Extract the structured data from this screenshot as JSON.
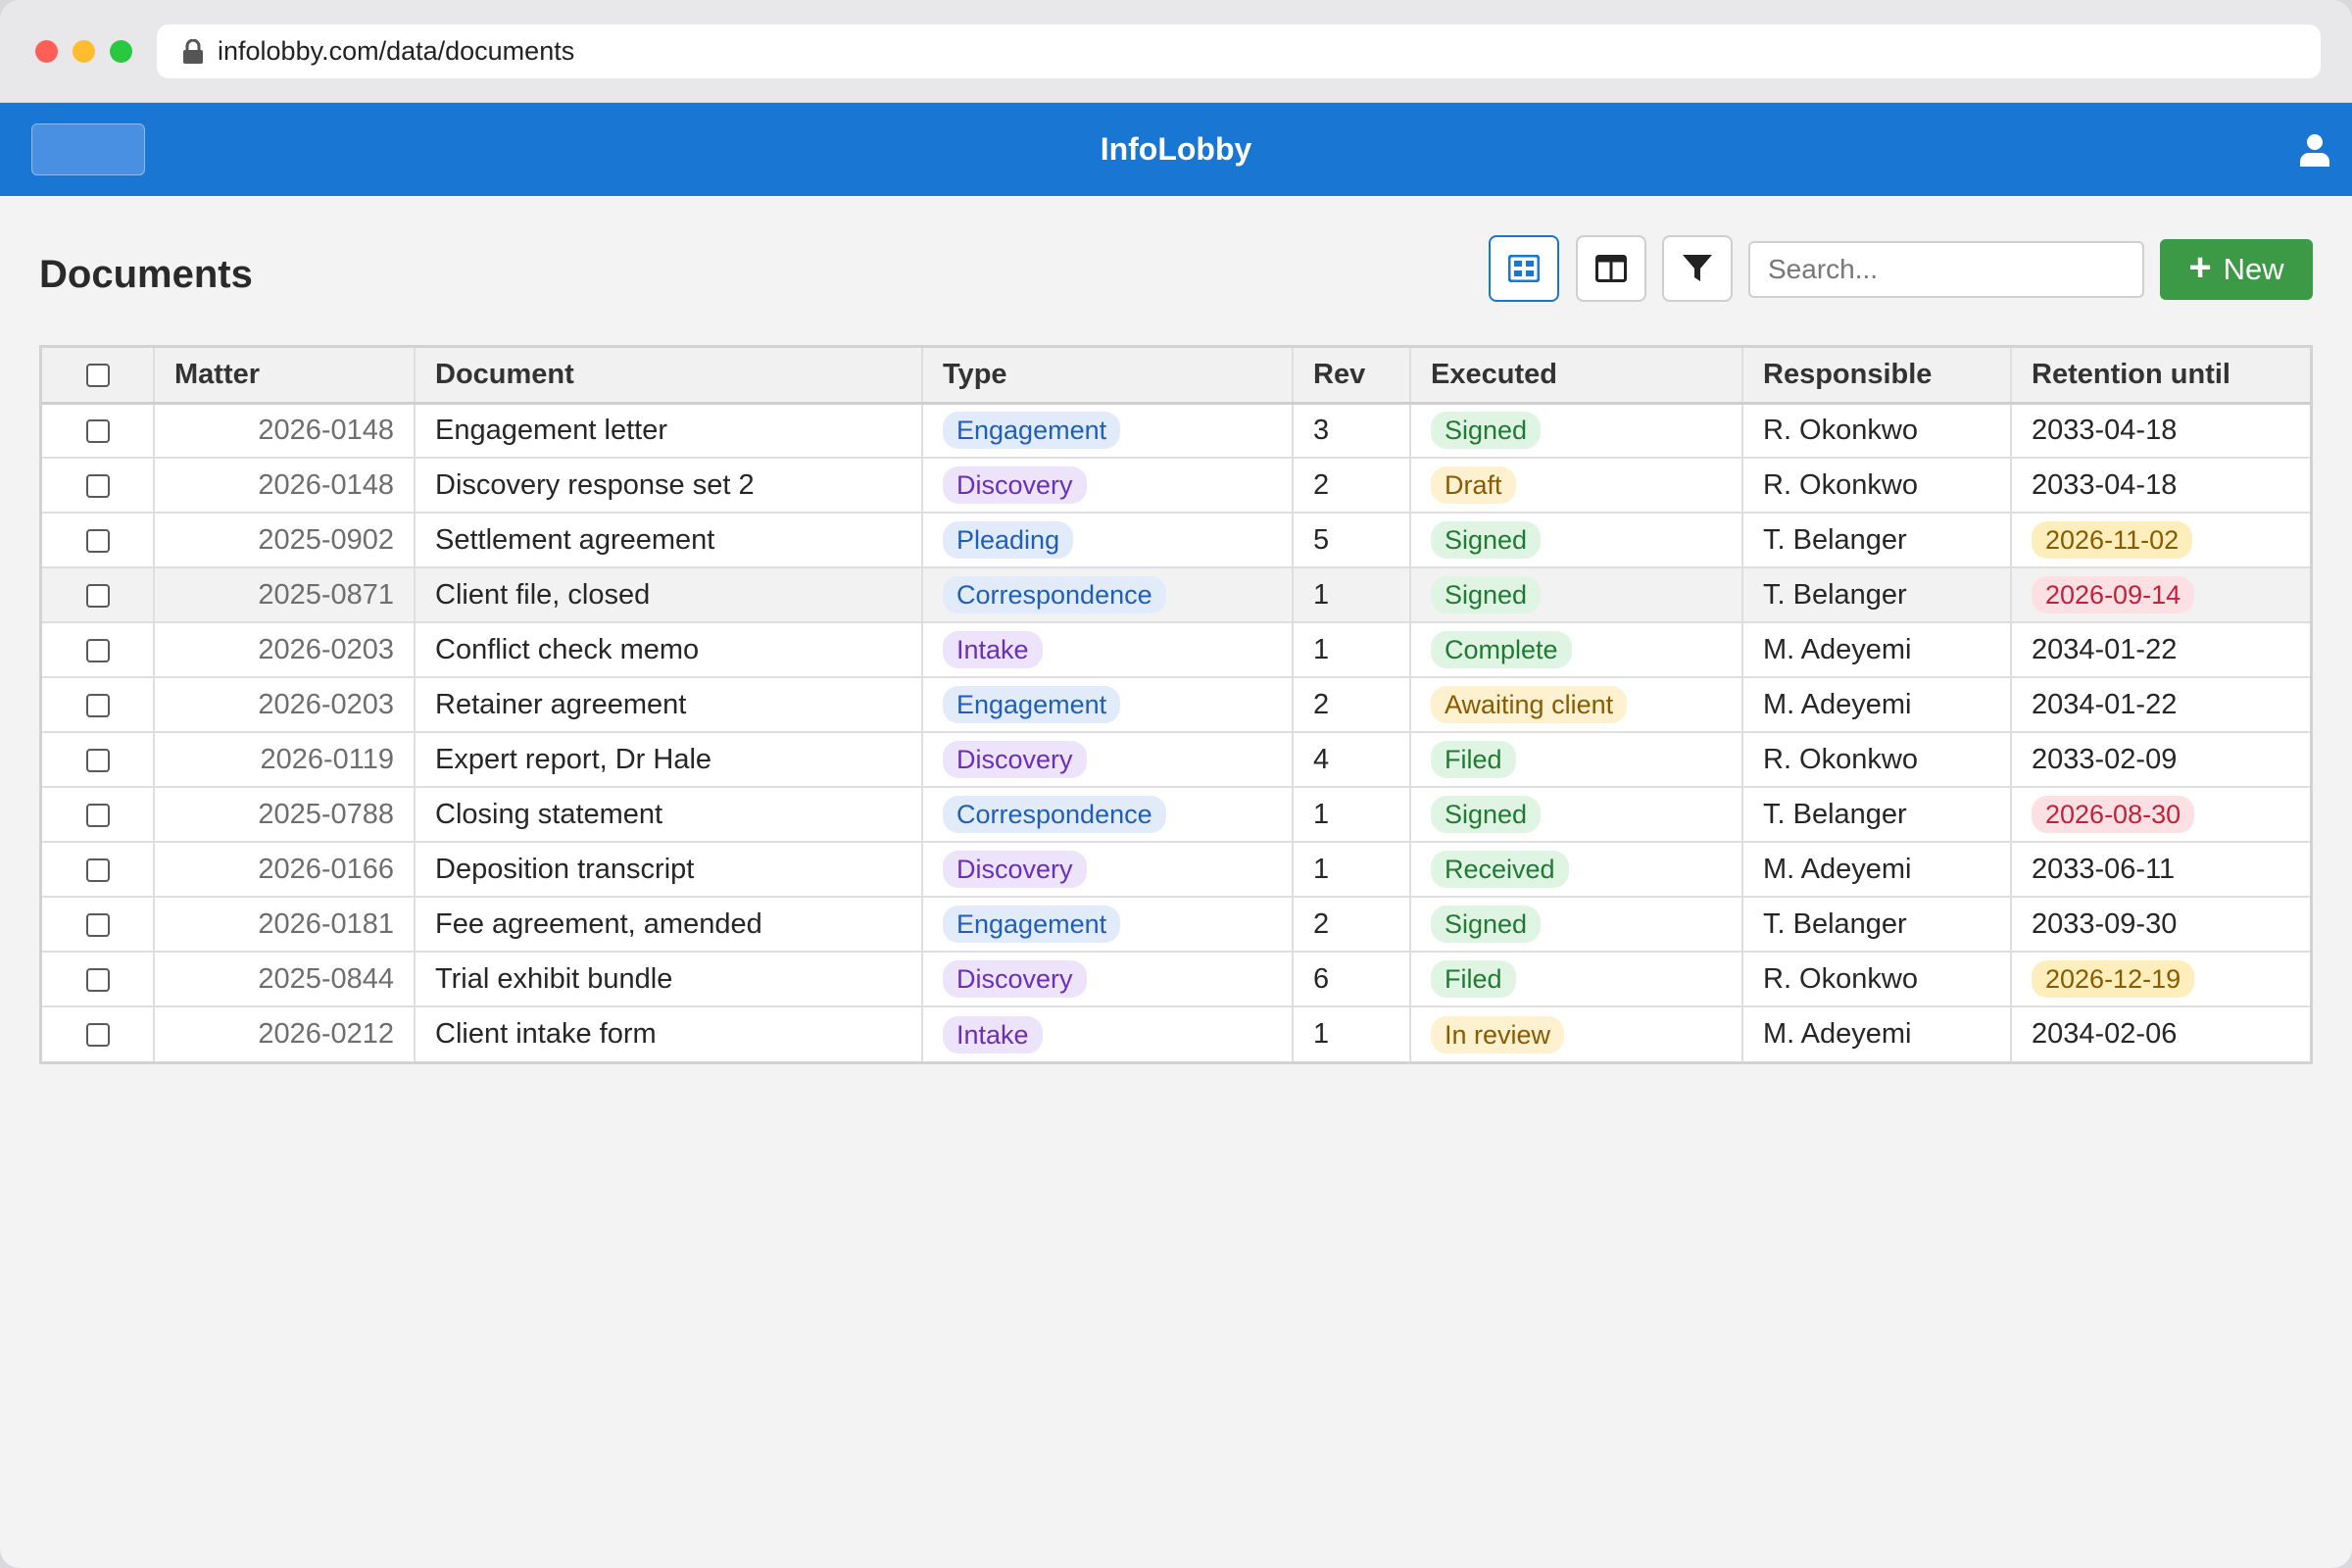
{
  "browser": {
    "url": "infolobby.com/data/documents"
  },
  "app": {
    "title": "InfoLobby"
  },
  "page": {
    "title": "Documents",
    "search_placeholder": "Search...",
    "new_label": "New"
  },
  "table": {
    "headers": {
      "matter": "Matter",
      "document": "Document",
      "type": "Type",
      "rev": "Rev",
      "executed": "Executed",
      "responsible": "Responsible",
      "retention": "Retention until"
    },
    "rows": [
      {
        "matter": "2026-0148",
        "document": "Engagement letter",
        "type": "Engagement",
        "rev": "3",
        "executed": "Signed",
        "executed_color": "green",
        "responsible": "R. Okonkwo",
        "retention": "2033-04-18",
        "retention_flag": ""
      },
      {
        "matter": "2026-0148",
        "document": "Discovery response set 2",
        "type": "Discovery",
        "rev": "2",
        "executed": "Draft",
        "executed_color": "amber",
        "responsible": "R. Okonkwo",
        "retention": "2033-04-18",
        "retention_flag": ""
      },
      {
        "matter": "2025-0902",
        "document": "Settlement agreement",
        "type": "Pleading",
        "rev": "5",
        "executed": "Signed",
        "executed_color": "green",
        "responsible": "T. Belanger",
        "retention": "2026-11-02",
        "retention_flag": "amber"
      },
      {
        "matter": "2025-0871",
        "document": "Client file, closed",
        "type": "Correspondence",
        "rev": "1",
        "executed": "Signed",
        "executed_color": "green",
        "responsible": "T. Belanger",
        "retention": "2026-09-14",
        "retention_flag": "red"
      },
      {
        "matter": "2026-0203",
        "document": "Conflict check memo",
        "type": "Intake",
        "rev": "1",
        "executed": "Complete",
        "executed_color": "green",
        "responsible": "M. Adeyemi",
        "retention": "2034-01-22",
        "retention_flag": ""
      },
      {
        "matter": "2026-0203",
        "document": "Retainer agreement",
        "type": "Engagement",
        "rev": "2",
        "executed": "Awaiting client",
        "executed_color": "amber",
        "responsible": "M. Adeyemi",
        "retention": "2034-01-22",
        "retention_flag": ""
      },
      {
        "matter": "2026-0119",
        "document": "Expert report, Dr Hale",
        "type": "Discovery",
        "rev": "4",
        "executed": "Filed",
        "executed_color": "green",
        "responsible": "R. Okonkwo",
        "retention": "2033-02-09",
        "retention_flag": ""
      },
      {
        "matter": "2025-0788",
        "document": "Closing statement",
        "type": "Correspondence",
        "rev": "1",
        "executed": "Signed",
        "executed_color": "green",
        "responsible": "T. Belanger",
        "retention": "2026-08-30",
        "retention_flag": "red"
      },
      {
        "matter": "2026-0166",
        "document": "Deposition transcript",
        "type": "Discovery",
        "rev": "1",
        "executed": "Received",
        "executed_color": "green",
        "responsible": "M. Adeyemi",
        "retention": "2033-06-11",
        "retention_flag": ""
      },
      {
        "matter": "2026-0181",
        "document": "Fee agreement, amended",
        "type": "Engagement",
        "rev": "2",
        "executed": "Signed",
        "executed_color": "green",
        "responsible": "T. Belanger",
        "retention": "2033-09-30",
        "retention_flag": ""
      },
      {
        "matter": "2025-0844",
        "document": "Trial exhibit bundle",
        "type": "Discovery",
        "rev": "6",
        "executed": "Filed",
        "executed_color": "green",
        "responsible": "R. Okonkwo",
        "retention": "2026-12-19",
        "retention_flag": "amber"
      },
      {
        "matter": "2026-0212",
        "document": "Client intake form",
        "type": "Intake",
        "rev": "1",
        "executed": "In review",
        "executed_color": "amber",
        "responsible": "M. Adeyemi",
        "retention": "2034-02-06",
        "retention_flag": ""
      }
    ]
  },
  "colors": {
    "appbar": "#1976d2",
    "new_button": "#3c9a47"
  },
  "icons": {
    "lock": "lock-icon",
    "user": "user-icon",
    "grid_view": "grid-view-icon",
    "columns_view": "columns-icon",
    "filter": "filter-icon",
    "plus": "plus-icon"
  }
}
